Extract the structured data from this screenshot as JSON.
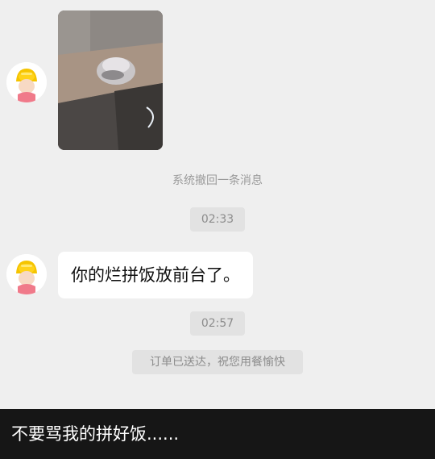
{
  "chat": {
    "system_recall_notice": "系统撤回一条消息",
    "time_1": "02:33",
    "message_text": "你的烂拼饭放前台了。",
    "time_2": "02:57",
    "order_notice": "订单已送达，祝您用餐愉快"
  },
  "caption": {
    "text": "不要骂我的拼好饭......"
  },
  "colors": {
    "chat_background": "#efefef",
    "bubble_background": "#ffffff",
    "pill_background": "#e2e2e2",
    "caption_background": "#161616",
    "caption_text": "#ffffff"
  },
  "icons": {
    "avatar": "yellow-cartoon-avatar-icon"
  }
}
